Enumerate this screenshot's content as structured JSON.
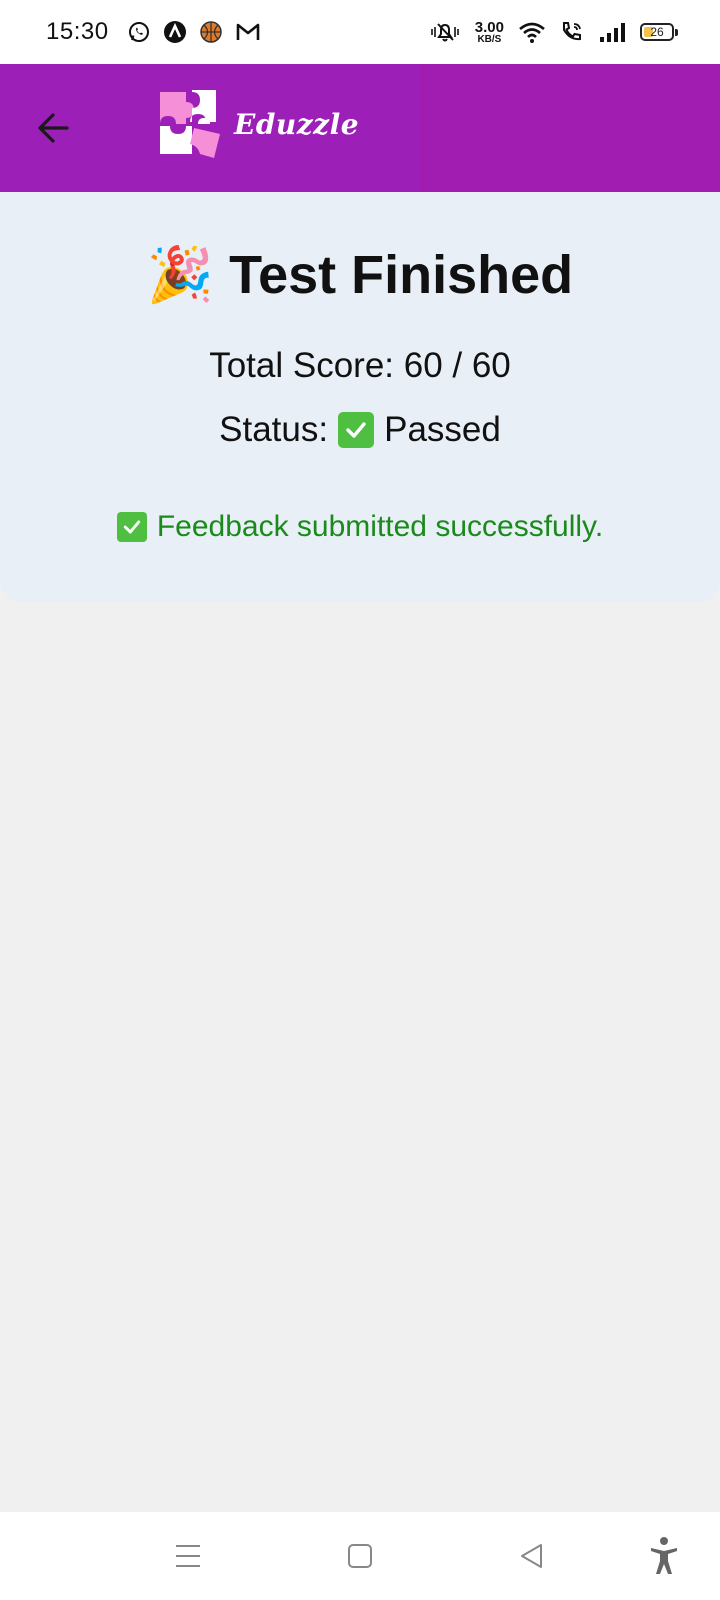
{
  "status_bar": {
    "time": "15:30",
    "left_icons": [
      "whatsapp-icon",
      "app-a-icon",
      "basketball-icon",
      "gmail-icon"
    ],
    "speed_value": "3.00",
    "speed_unit": "KB/S",
    "right_icons": [
      "mute-icon",
      "wifi-icon",
      "wifi-call-icon",
      "signal-icon",
      "battery-icon"
    ],
    "battery_level": "26"
  },
  "app_bar": {
    "back_icon": "arrow-left-icon",
    "logo_text": "Eduzzle",
    "colors": {
      "background": "#a11db2",
      "logo_pink": "#f48fd8"
    }
  },
  "result": {
    "emoji": "🎉",
    "title": "Test Finished",
    "score_text": "Total Score: 60 / 60",
    "status_label": "Status:",
    "status_value": "Passed",
    "feedback": "Feedback submitted successfully.",
    "colors": {
      "card_bg": "#e8eff7",
      "feedback_text": "#1a8a1a",
      "check_green": "#4fbf42"
    }
  },
  "nav_bar": {
    "icons": [
      "menu-icon",
      "home-square-icon",
      "back-triangle-icon",
      "accessibility-icon"
    ]
  }
}
